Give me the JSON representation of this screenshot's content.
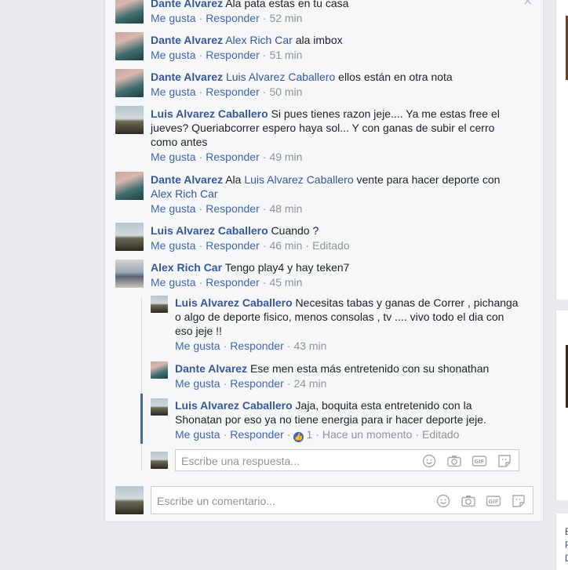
{
  "comments": [
    {
      "author": "Dante Alvarez",
      "text": "Ala pata estas en tu casa",
      "like": "Me gusta",
      "reply": "Responder",
      "time": "52 min"
    },
    {
      "author": "Dante Alvarez",
      "mention": "Alex Rich Car",
      "text": "ala imbox",
      "like": "Me gusta",
      "reply": "Responder",
      "time": "51 min"
    },
    {
      "author": "Dante Alvarez",
      "mention": "Luis Alvarez Caballero",
      "text": "ellos están en otra nota",
      "like": "Me gusta",
      "reply": "Responder",
      "time": "50 min"
    },
    {
      "author": "Luis Alvarez Caballero",
      "text": "Si pues tienes razon jeje.... Ya me estas free el jueves? Queriabcorrer espero haya sol... Y con ganas de subir el cerro como antes",
      "like": "Me gusta",
      "reply": "Responder",
      "time": "49 min"
    },
    {
      "author": "Dante Alvarez",
      "pre": "Ala",
      "mention": "Luis Alvarez Caballero",
      "text": "vente para hacer deporte con",
      "mention2": "Alex Rich Car",
      "like": "Me gusta",
      "reply": "Responder",
      "time": "48 min"
    },
    {
      "author": "Luis Alvarez Caballero",
      "text": "Cuando ?",
      "like": "Me gusta",
      "reply": "Responder",
      "time": "46 min",
      "edited": "Editado"
    },
    {
      "author": "Alex Rich Car",
      "text": "Tengo play4 y hay teken7",
      "like": "Me gusta",
      "reply": "Responder",
      "time": "45 min"
    }
  ],
  "replies": [
    {
      "author": "Luis Alvarez Caballero",
      "text": "Necesitas tabas y ganas de Correr , pichanga o algo de deporte fisico, menos consolas , tv .... vivo todo el dia con eso jeje !!",
      "like": "Me gusta",
      "reply": "Responder",
      "time": "43 min"
    },
    {
      "author": "Dante Alvarez",
      "text": "Ese men esta más entretenido con su shonathan",
      "like": "Me gusta",
      "reply": "Responder",
      "time": "24 min"
    },
    {
      "author": "Luis Alvarez Caballero",
      "text": "Jaja, boquita esta entretenido con la Shonatan por eso ya no tiene energia para ir hacer deporte jeje.",
      "like": "Me gusta",
      "reply": "Responder",
      "likes_count": "1",
      "time": "Hace un momento",
      "edited": "Editado"
    }
  ],
  "reply_input": {
    "placeholder": "Escribe una respuesta..."
  },
  "comment_input": {
    "placeholder": "Escribe un comentario..."
  },
  "icons": [
    "emoji-icon",
    "camera-icon",
    "gif-icon",
    "sticker-icon",
    "close-icon",
    "like-icon"
  ],
  "side_text": {
    "l1": "E",
    "l2": "F",
    "l3": "D"
  },
  "colors": {
    "link": "#365899",
    "action": "#4267b2",
    "meta": "#90949c",
    "bg": "#e9ebee"
  }
}
